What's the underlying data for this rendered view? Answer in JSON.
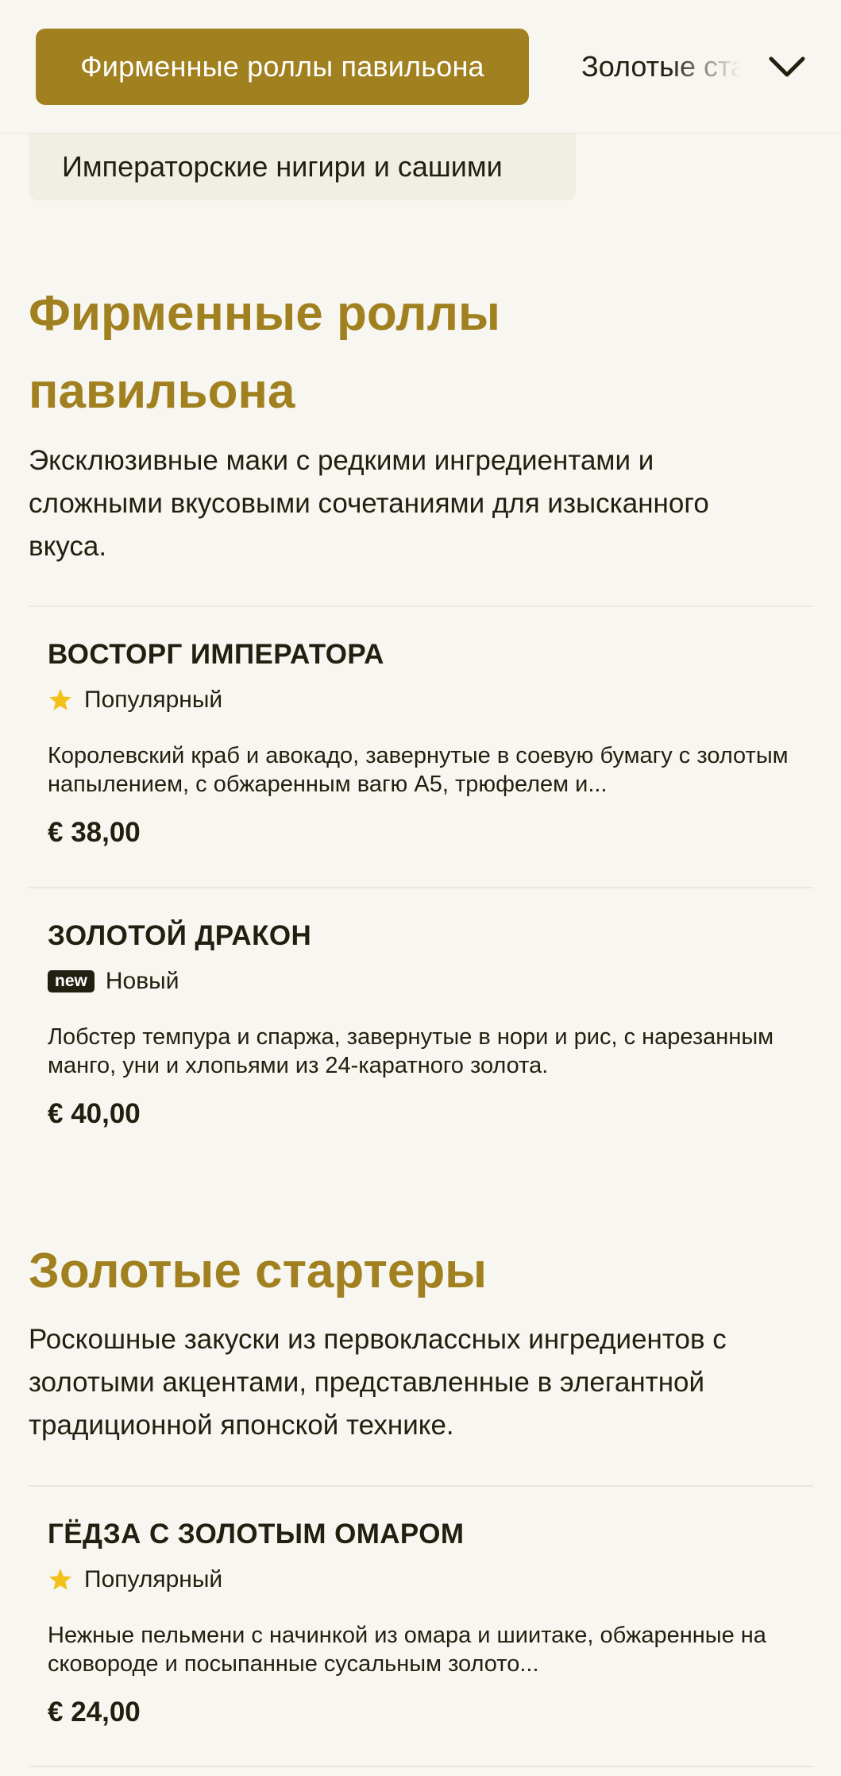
{
  "nav": {
    "active_category": "Фирменные роллы павильона",
    "next_category": "Золотые стартеры",
    "second_row_category": "Императорские нигири и сашими",
    "expand_icon": "chevron-down-icon"
  },
  "sections": [
    {
      "title_line1": "Фирменные роллы",
      "title_line2": "павильона",
      "desc_line1": "Эксклюзивные маки с редкими ингредиентами и",
      "desc_line2": "сложными вкусовыми сочетаниями для изысканного",
      "desc_line3": "вкуса.",
      "items": [
        {
          "name": "ВОСТОРГ ИМПЕРАТОРА",
          "badge_icon": "star-icon",
          "badge": "Популярный",
          "desc": "Королевский краб и авокадо, завернутые в соевую бумагу с золотым напылением, с обжаренным вагю А5, трюфелем и...",
          "price": "€ 38,00"
        },
        {
          "name": "ЗОЛОТОЙ ДРАКОН",
          "badge_icon_text": "new",
          "badge": "Новый",
          "desc": "Лобстер темпура и спаржа, завернутые в нори и рис, с нарезанным манго, уни и хлопьями из 24-каратного золота.",
          "price": "€ 40,00"
        }
      ]
    },
    {
      "title": "Золотые стартеры",
      "desc_line1": "Роскошные закуски из первоклассных ингредиентов с",
      "desc_line2": "золотыми акцентами, представленные в элегантной",
      "desc_line3": "традиционной японской технике.",
      "items": [
        {
          "name": "ГЁДЗА С ЗОЛОТЫМ ОМАРОМ",
          "badge_icon": "star-icon",
          "badge": "Популярный",
          "desc": "Нежные пельмени с начинкой из омара и шиитаке, обжаренные на сковороде и посыпанные сусальным золото...",
          "price": "€ 24,00"
        }
      ]
    }
  ],
  "colors": {
    "accent": "#a0801f",
    "background": "#f8f6f1",
    "pill_inactive": "#f1eee4",
    "text": "#231f10",
    "star": "#f2c21b"
  }
}
